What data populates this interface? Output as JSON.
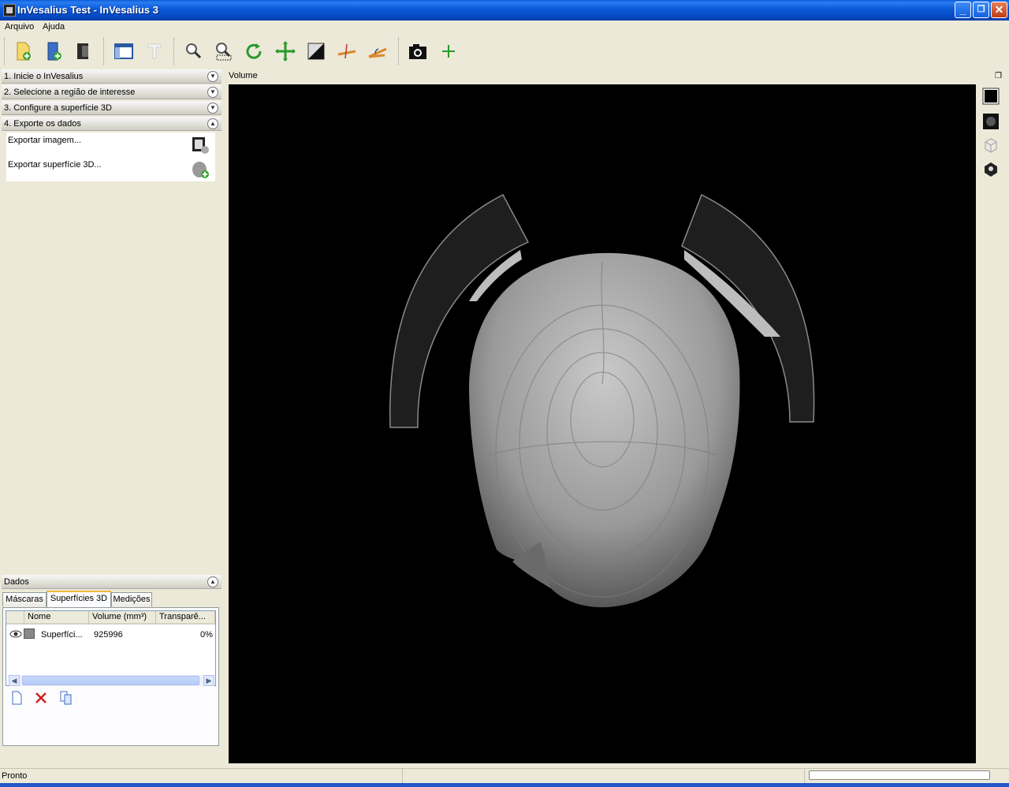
{
  "window": {
    "title": "InVesalius Test - InVesalius 3"
  },
  "menubar": {
    "items": [
      "Arquivo",
      "Ajuda"
    ]
  },
  "toolbar": {
    "buttons": [
      "import-icon",
      "open-project-icon",
      "close-project-icon",
      "layout-icon",
      "text-icon",
      "zoom-icon",
      "zoom-select-icon",
      "rotate-icon",
      "pan-icon",
      "contrast-icon",
      "measure-linear-icon",
      "measure-angular-icon",
      "snapshot-icon",
      "add-icon"
    ]
  },
  "left_panel": {
    "sections": [
      {
        "label": "1. Inicie o InVesalius",
        "expanded": false
      },
      {
        "label": "2. Selecione a região de interesse",
        "expanded": false
      },
      {
        "label": "3. Configure a superfície 3D",
        "expanded": false
      },
      {
        "label": "4. Exporte os dados",
        "expanded": true
      }
    ],
    "export": {
      "image_label": "Exportar imagem...",
      "surface_label": "Exportar superfície 3D..."
    }
  },
  "data_panel": {
    "title": "Dados",
    "tabs": [
      "Máscaras",
      "Superfícies 3D",
      "Medições"
    ],
    "active_tab": "Superfícies 3D",
    "columns": [
      "Nome",
      "Volume (mm³)",
      "Transparê..."
    ],
    "rows": [
      {
        "name": "Superfíci...",
        "volume": "925996",
        "transparency": "0%"
      }
    ]
  },
  "viewport": {
    "title": "Volume"
  },
  "statusbar": {
    "text": "Pronto"
  },
  "colors": {
    "titlebar": "#0a58d6",
    "panel_bg": "#ece9d8",
    "viewport_bg": "#000000"
  }
}
